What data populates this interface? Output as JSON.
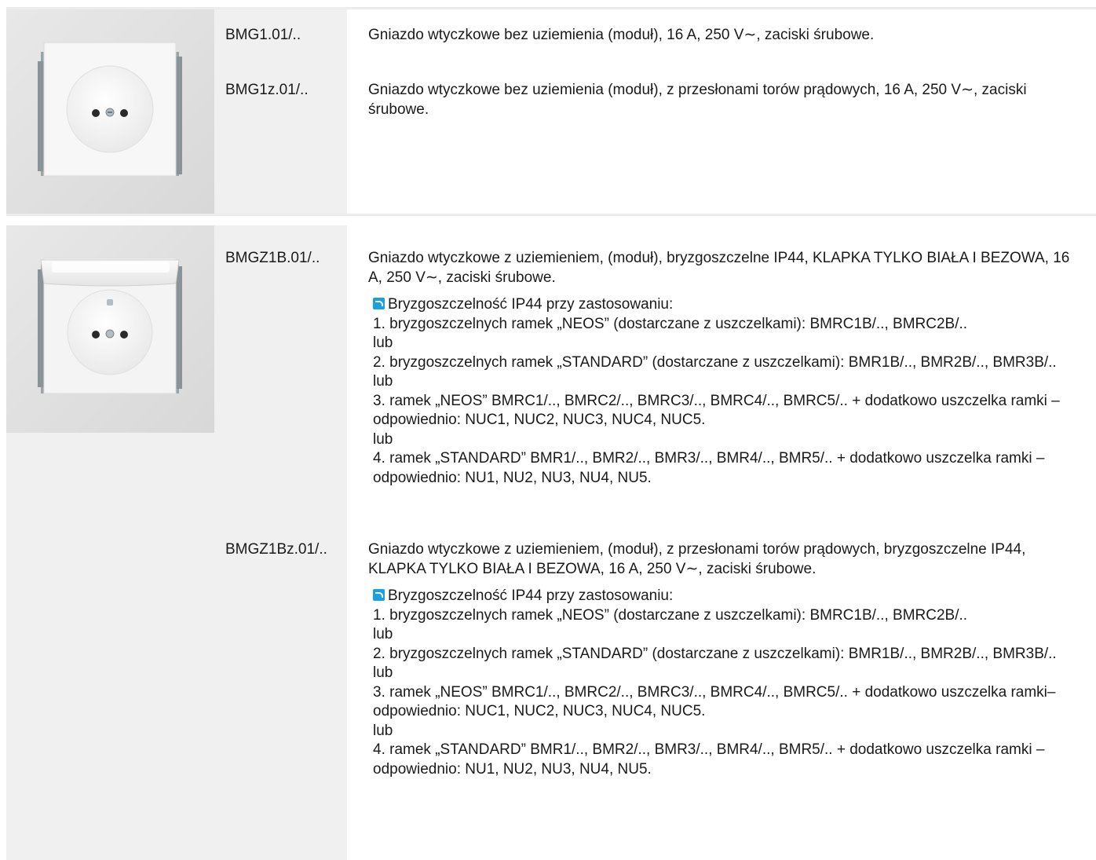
{
  "products": [
    {
      "items": [
        {
          "code": "BMG1.01/..",
          "description": "Gniazdo wtyczkowe bez uziemienia (moduł), 16 A, 250 V∼, zaciski śrubowe."
        },
        {
          "code": "BMG1z.01/..",
          "description": "Gniazdo wtyczkowe bez uziemienia (moduł), z przesłonami torów prądowych, 16 A, 250 V∼, zaciski śrubowe."
        }
      ]
    },
    {
      "items": [
        {
          "code": "BMGZ1B.01/..",
          "description": "Gniazdo wtyczkowe z uziemieniem, (moduł), bryzgoszczelne IP44, KLAPKA TYLKO BIAŁA I BEZOWA, 16 A, 250 V∼, zaciski śrubowe.",
          "note": {
            "heading": "Bryzgoszczelność IP44 przy zastosowaniu:",
            "opt1": "1. bryzgoszczelnych ramek „NEOS” (dostarczane z uszczelkami): BMRC1B/.., BMRC2B/..",
            "or1": "lub",
            "opt2": "2. bryzgoszczelnych ramek „STANDARD” (dostarczane z uszczelkami): BMR1B/.., BMR2B/.., BMR3B/..",
            "or2": "lub",
            "opt3": "3. ramek „NEOS” BMRC1/.., BMRC2/.., BMRC3/.., BMRC4/.., BMRC5/.. + dodatkowo uszczelka ramki – odpowiednio: NUC1, NUC2, NUC3, NUC4, NUC5.",
            "or3": "lub",
            "opt4": "4. ramek „STANDARD” BMR1/.., BMR2/.., BMR3/.., BMR4/.., BMR5/.. + dodatkowo uszczelka ramki – odpowiednio: NU1, NU2, NU3, NU4, NU5."
          }
        },
        {
          "code": "BMGZ1Bz.01/..",
          "description": "Gniazdo wtyczkowe z uziemieniem, (moduł), z przesłonami torów prądowych, bryzgoszczelne IP44, KLAPKA TYLKO BIAŁA I BEZOWA, 16 A, 250 V∼, zaciski śrubowe.",
          "note": {
            "heading": "Bryzgoszczelność IP44 przy zastosowaniu:",
            "opt1": "1. bryzgoszczelnych ramek „NEOS” (dostarczane z uszczelkami): BMRC1B/.., BMRC2B/..",
            "or1": "lub",
            "opt2": "2. bryzgoszczelnych ramek „STANDARD” (dostarczane z uszczelkami): BMR1B/.., BMR2B/.., BMR3B/..",
            "or2": "lub",
            "opt3": "3. ramek „NEOS” BMRC1/.., BMRC2/.., BMRC3/.., BMRC4/.., BMRC5/.. + dodatkowo uszczelka ramki– odpowiednio: NUC1, NUC2, NUC3, NUC4, NUC5.",
            "or3": "lub",
            "opt4": "4. ramek „STANDARD” BMR1/.., BMR2/.., BMR3/.., BMR4/.., BMR5/.. + dodatkowo uszczelka ramki – odpowiednio: NU1, NU2, NU3, NU4, NU5."
          }
        }
      ]
    }
  ]
}
